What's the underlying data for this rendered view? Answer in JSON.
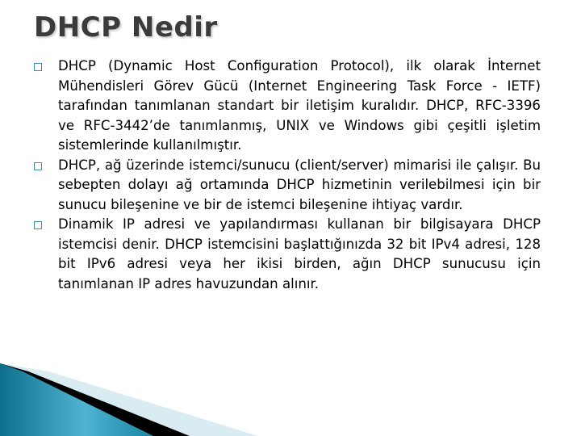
{
  "slide": {
    "title": "DHCP Nedir",
    "bullets": [
      {
        "text": "DHCP (Dynamic Host Configuration Protocol), ilk olarak İnternet Mühendisleri Görev Gücü (Internet Engineering Task Force - IETF) tarafından tanımlanan standart bir iletişim kuralıdır. DHCP, RFC-3396 ve RFC-3442’de tanımlanmış, UNIX ve Windows gibi çeşitli işletim sistemlerinde kullanılmıştır."
      },
      {
        "text": "DHCP, ağ üzerinde istemci/sunucu (client/server) mimarisi ile çalışır. Bu sebepten dolayı ağ ortamında DHCP hizmetinin verilebilmesi için bir sunucu bileşenine ve bir de istemci bileşenine ihtiyaç vardır."
      },
      {
        "text": "Dinamik IP adresi ve yapılandırması kullanan bir bilgisayara DHCP istemcisi denir. DHCP istemcisini başlattığınızda 32 bit IPv4 adresi, 128 bit IPv6 adresi veya her ikisi birden, ağın DHCP sunucusu için tanımlanan IP adres havuzundan alınır."
      }
    ],
    "bullet_icon": "square-bullet-icon",
    "colors": {
      "title": "#3b3b3b",
      "accent": "#1b8aa8",
      "bullet": "#3d8fa6"
    }
  }
}
